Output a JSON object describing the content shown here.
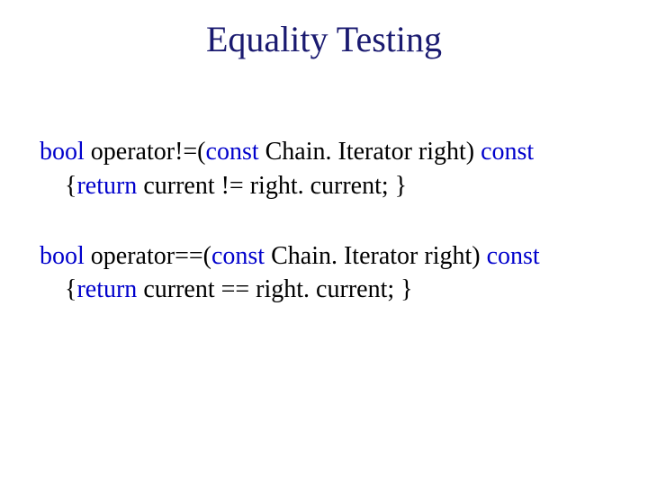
{
  "title": "Equality Testing",
  "kw": {
    "bool": "bool",
    "const": "const",
    "return": "return"
  },
  "line1": {
    "a": " operator!=(",
    "b": " Chain. Iterator right) "
  },
  "line2": {
    "a": " {",
    "b": " current != right. current; }"
  },
  "line3": {
    "a": " operator==(",
    "b": " Chain. Iterator right) "
  },
  "line4": {
    "a": " {",
    "b": " current == right. current; }"
  }
}
